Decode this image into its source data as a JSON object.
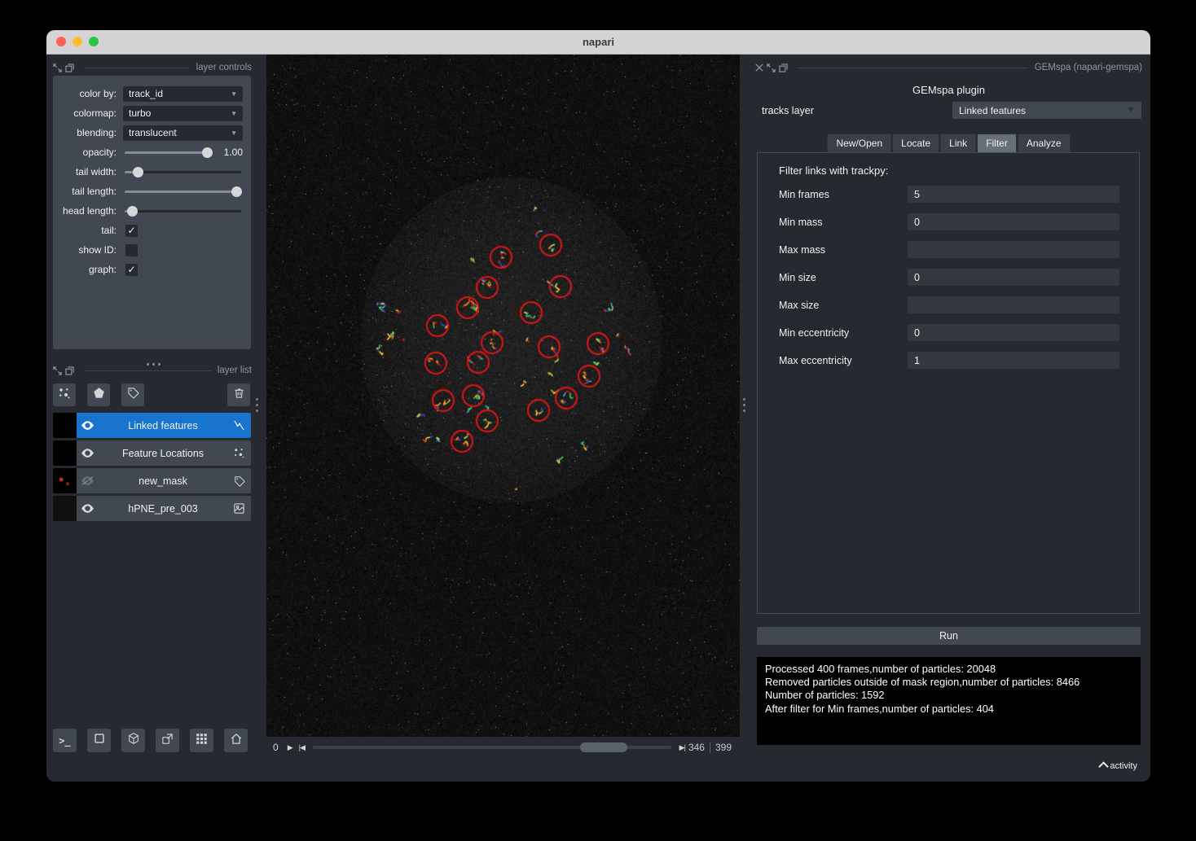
{
  "window": {
    "title": "napari"
  },
  "colors": {
    "selected_layer": "#1874cd",
    "track_circle": "#e01515",
    "accent_panel": "#414851"
  },
  "layer_controls": {
    "panel_title": "layer controls",
    "rows": {
      "color_by": {
        "label": "color by:",
        "value": "track_id"
      },
      "colormap": {
        "label": "colormap:",
        "value": "turbo"
      },
      "blending": {
        "label": "blending:",
        "value": "translucent"
      },
      "opacity": {
        "label": "opacity:",
        "value": "1.00"
      },
      "tail_width": {
        "label": "tail width:"
      },
      "tail_length": {
        "label": "tail length:"
      },
      "head_length": {
        "label": "head length:"
      },
      "tail": {
        "label": "tail:",
        "checked": true
      },
      "show_id": {
        "label": "show ID:",
        "checked": false
      },
      "graph": {
        "label": "graph:",
        "checked": true
      }
    }
  },
  "layer_list": {
    "panel_title": "layer list",
    "layers": [
      {
        "name": "Linked features",
        "selected": true,
        "visible": true,
        "type": "tracks"
      },
      {
        "name": "Feature Locations",
        "selected": false,
        "visible": true,
        "type": "points"
      },
      {
        "name": "new_mask",
        "selected": false,
        "visible": false,
        "type": "labels"
      },
      {
        "name": "hPNE_pre_003",
        "selected": false,
        "visible": true,
        "type": "image"
      }
    ]
  },
  "viewer": {
    "current_frame": "0",
    "frame_position": "346",
    "frame_total": "399"
  },
  "plugin": {
    "dock_title": "GEMspa (napari-gemspa)",
    "title": "GEMspa plugin",
    "tracks_layer_label": "tracks layer",
    "tracks_layer_value": "Linked features",
    "tabs": [
      "New/Open",
      "Locate",
      "Link",
      "Filter",
      "Analyze"
    ],
    "active_tab": "Filter",
    "filter_section": {
      "heading": "Filter links with trackpy:",
      "fields": [
        {
          "label": "Min frames",
          "value": "5"
        },
        {
          "label": "Min mass",
          "value": "0"
        },
        {
          "label": "Max mass",
          "value": ""
        },
        {
          "label": "Min size",
          "value": "0"
        },
        {
          "label": "Max size",
          "value": ""
        },
        {
          "label": "Min eccentricity",
          "value": "0"
        },
        {
          "label": "Max eccentricity",
          "value": "1"
        }
      ]
    },
    "run_label": "Run",
    "log_lines": [
      "Processed 400 frames,number of particles: 20048",
      "Removed particles outside of mask region,number of particles: 8466",
      "Number of particles: 1592",
      "After filter for Min frames,number of particles: 404"
    ]
  },
  "status": {
    "activity_label": "activity"
  }
}
